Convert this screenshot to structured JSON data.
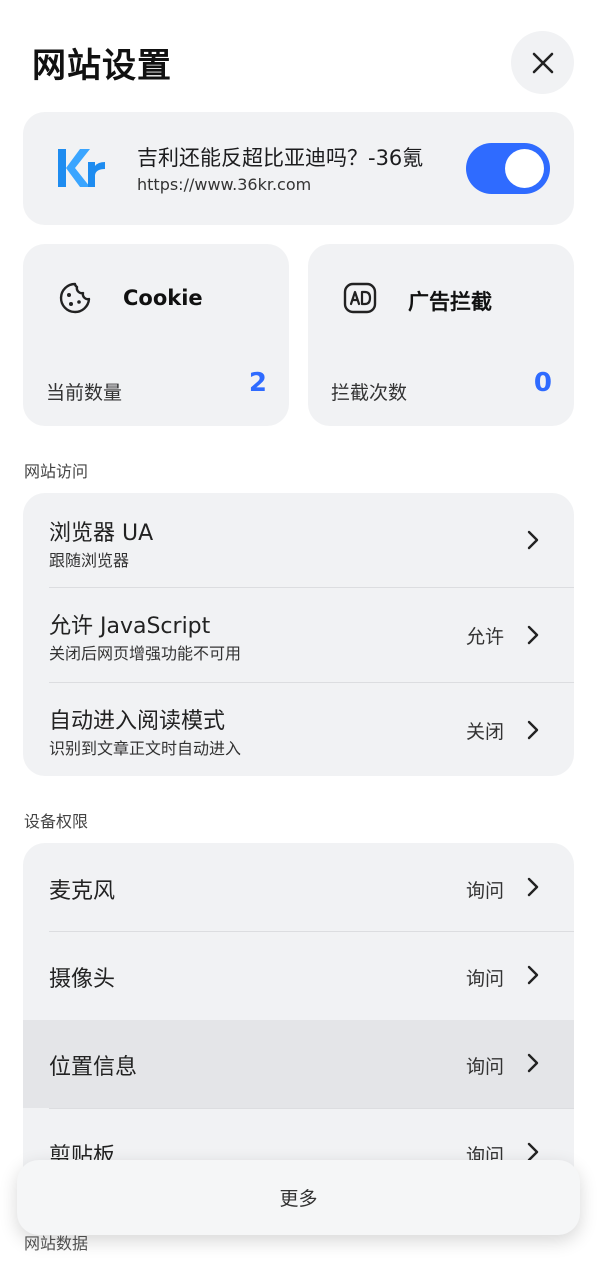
{
  "header": {
    "title": "网站设置"
  },
  "site": {
    "title": "吉利还能反超比亚迪吗？-36氪",
    "url": "https://www.36kr.com",
    "enabled": true
  },
  "stats": {
    "cookie": {
      "title": "Cookie",
      "label": "当前数量",
      "value": "2"
    },
    "adblock": {
      "title": "广告拦截",
      "label": "拦截次数",
      "value": "0"
    }
  },
  "sections": {
    "site_access": {
      "label": "网站访问",
      "rows": [
        {
          "title": "浏览器 UA",
          "subtitle": "跟随浏览器",
          "value": ""
        },
        {
          "title": "允许 JavaScript",
          "subtitle": "关闭后网页增强功能不可用",
          "value": "允许"
        },
        {
          "title": "自动进入阅读模式",
          "subtitle": "识别到文章正文时自动进入",
          "value": "关闭"
        }
      ]
    },
    "device_permissions": {
      "label": "设备权限",
      "rows": [
        {
          "title": "麦克风",
          "value": "询问"
        },
        {
          "title": "摄像头",
          "value": "询问"
        },
        {
          "title": "位置信息",
          "value": "询问"
        },
        {
          "title": "剪贴板",
          "value": "询问"
        }
      ]
    },
    "site_data": {
      "label": "网站数据"
    }
  },
  "more": {
    "label": "更多"
  },
  "colors": {
    "accent": "#2f6bff",
    "card_bg": "#f1f2f4",
    "logo_blue": "#1e8cf0"
  },
  "icons": {
    "close": "close-icon",
    "site_logo": "kr-logo",
    "cookie": "cookie-icon",
    "adblock": "ad-icon",
    "chevron": "chevron-right-icon"
  }
}
